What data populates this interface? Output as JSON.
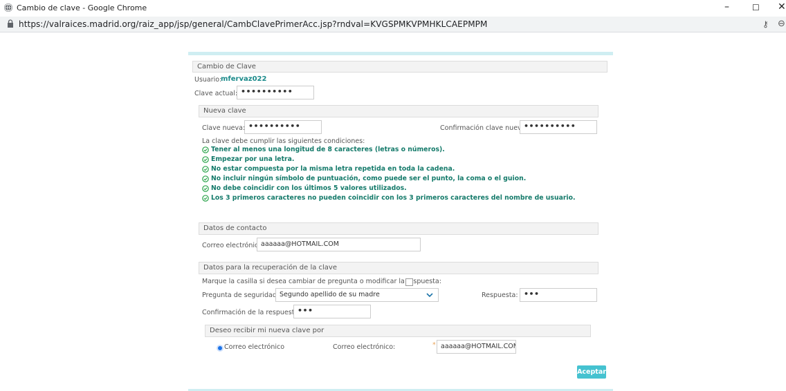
{
  "browser": {
    "window_title": "Cambio de clave - Google Chrome",
    "url": "https://valraices.madrid.org/raiz_app/jsp/general/CambClavePrimerAcc.jsp?rndval=KVGSPMKVPMHKLCAEPMPM",
    "minimize": "–",
    "maximize": "☐",
    "close": "✕"
  },
  "form": {
    "section_title": "Cambio de Clave",
    "usuario_label": "Usuario:",
    "usuario_value": "mfervaz022",
    "clave_actual_label": "Clave actual:",
    "clave_actual_value": "••••••••••",
    "required_mark": "*"
  },
  "nueva_clave": {
    "header": "Nueva clave",
    "clave_nueva_label": "Clave nueva:",
    "clave_nueva_value": "••••••••••",
    "confirmacion_label": "Confirmación clave nueva:",
    "confirmacion_value": "••••••••••",
    "conditions_intro": "La clave debe cumplir las siguientes condiciones:",
    "conditions": [
      "Tener al menos una longitud de 8 caracteres (letras o números).",
      "Empezar por una letra.",
      "No estar compuesta por la misma letra repetida en toda la cadena.",
      "No incluir ningún símbolo de puntuación, como puede ser el punto, la coma o el guion.",
      "No debe coincidir con los últimos 5 valores utilizados.",
      "Los 3 primeros caracteres no pueden coincidir con los 3 primeros caracteres del nombre de usuario."
    ]
  },
  "contacto": {
    "header": "Datos de contacto",
    "correo_label": "Correo electrónico:",
    "correo_value": "aaaaaa@HOTMAIL.COM"
  },
  "recuperacion": {
    "header": "Datos para la recuperación de la clave",
    "marque_label": "Marque la casilla si desea cambiar de pregunta o modificar la respuesta:",
    "pregunta_label": "Pregunta de seguridad:",
    "pregunta_value": "Segundo apellido de su madre",
    "respuesta_label": "Respuesta:",
    "respuesta_value": "•••",
    "confirmacion_respuesta_label": "Confirmación de la respuesta:",
    "confirmacion_respuesta_value": "•••"
  },
  "deseo": {
    "header": "Deseo recibir mi nueva clave por",
    "radio_label": "Correo electrónico",
    "correo_label": "Correo electrónico:",
    "correo_value": "aaaaaa@HOTMAIL.COM"
  },
  "actions": {
    "aceptar": "Aceptar"
  },
  "colors": {
    "accent": "#45c2d0",
    "condition_text": "#147a6a",
    "required": "#e8a45a",
    "topbar": "#cfeef2"
  }
}
